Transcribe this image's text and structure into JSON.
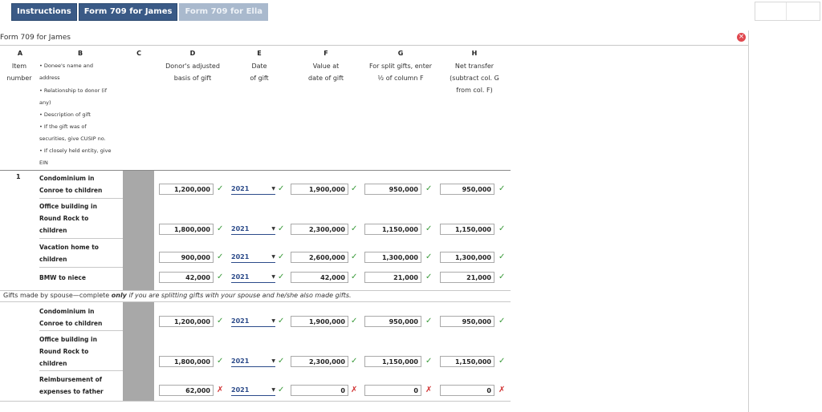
{
  "tabs": [
    {
      "label": "Instructions",
      "state": "active"
    },
    {
      "label": "Form 709 for James",
      "state": "active"
    },
    {
      "label": "Form 709 for Ella",
      "state": "inactive"
    }
  ],
  "panel": {
    "title": "Form 709 for James",
    "close_icon": "close-icon"
  },
  "columns": {
    "A": {
      "letter": "A",
      "lines": [
        "Item",
        "number"
      ]
    },
    "B": {
      "letter": "B",
      "lines": [
        "• Donee's name and",
        "address",
        "• Relationship to donor (if",
        "any)",
        "• Description of gift",
        "• If the gift was of",
        "securities, give CUSIP no.",
        "• If closely held entity, give",
        "EIN"
      ]
    },
    "C": {
      "letter": "C"
    },
    "D": {
      "letter": "D",
      "lines": [
        "Donor's adjusted",
        "basis of gift"
      ]
    },
    "E": {
      "letter": "E",
      "lines": [
        "Date",
        "of gift"
      ]
    },
    "F": {
      "letter": "F",
      "lines": [
        "Value at",
        "date of gift"
      ]
    },
    "G": {
      "letter": "G",
      "lines": [
        "For split gifts, enter",
        "½ of column F"
      ]
    },
    "H": {
      "letter": "H",
      "lines": [
        "Net transfer",
        "(subtract col. G",
        "from col. F)"
      ]
    }
  },
  "rows": [
    {
      "item": "1",
      "desc": [
        "Condominium in",
        "Conroe to children"
      ],
      "d": "1,200,000",
      "d_ok": true,
      "e": "2021",
      "f": "1,900,000",
      "f_ok": true,
      "g": "950,000",
      "g_ok": true,
      "h": "950,000",
      "h_ok": true
    },
    {
      "item": "",
      "desc": [
        "Office building in",
        "Round Rock to",
        "children"
      ],
      "d": "1,800,000",
      "d_ok": true,
      "e": "2021",
      "f": "2,300,000",
      "f_ok": true,
      "g": "1,150,000",
      "g_ok": true,
      "h": "1,150,000",
      "h_ok": true
    },
    {
      "item": "",
      "desc": [
        "Vacation home to",
        "children"
      ],
      "d": "900,000",
      "d_ok": true,
      "e": "2021",
      "f": "2,600,000",
      "f_ok": true,
      "g": "1,300,000",
      "g_ok": true,
      "h": "1,300,000",
      "h_ok": true
    },
    {
      "item": "",
      "desc": [
        "BMW to niece"
      ],
      "d": "42,000",
      "d_ok": true,
      "e": "2021",
      "f": "42,000",
      "f_ok": true,
      "g": "21,000",
      "g_ok": true,
      "h": "21,000",
      "h_ok": true
    }
  ],
  "spouse_note": {
    "pre": "Gifts made by spouse—complete ",
    "bold": "only",
    "post": " if you are splitting gifts with your spouse and he/she also made gifts."
  },
  "spouse_rows": [
    {
      "desc": [
        "Condominium in",
        "Conroe to children"
      ],
      "d": "1,200,000",
      "d_ok": true,
      "e": "2021",
      "f": "1,900,000",
      "f_ok": true,
      "g": "950,000",
      "g_ok": true,
      "h": "950,000",
      "h_ok": true
    },
    {
      "desc": [
        "Office building in",
        "Round Rock to",
        "children"
      ],
      "d": "1,800,000",
      "d_ok": true,
      "e": "2021",
      "f": "2,300,000",
      "f_ok": true,
      "g": "1,150,000",
      "g_ok": true,
      "h": "1,150,000",
      "h_ok": true
    },
    {
      "desc": [
        "Reimbursement of",
        "expenses to father"
      ],
      "d": "62,000",
      "d_ok": false,
      "e": "2021",
      "f": "0",
      "f_ok": false,
      "g": "0",
      "g_ok": false,
      "h": "0",
      "h_ok": false
    }
  ],
  "marks": {
    "ok": "✓",
    "bad": "✗",
    "dropdown": "▼"
  },
  "colors": {
    "tab_active": "#3a5a86",
    "tab_inactive": "#a9b9cd",
    "ok": "#3a9a3a",
    "bad": "#d03030",
    "select": "#2c4b8a"
  }
}
